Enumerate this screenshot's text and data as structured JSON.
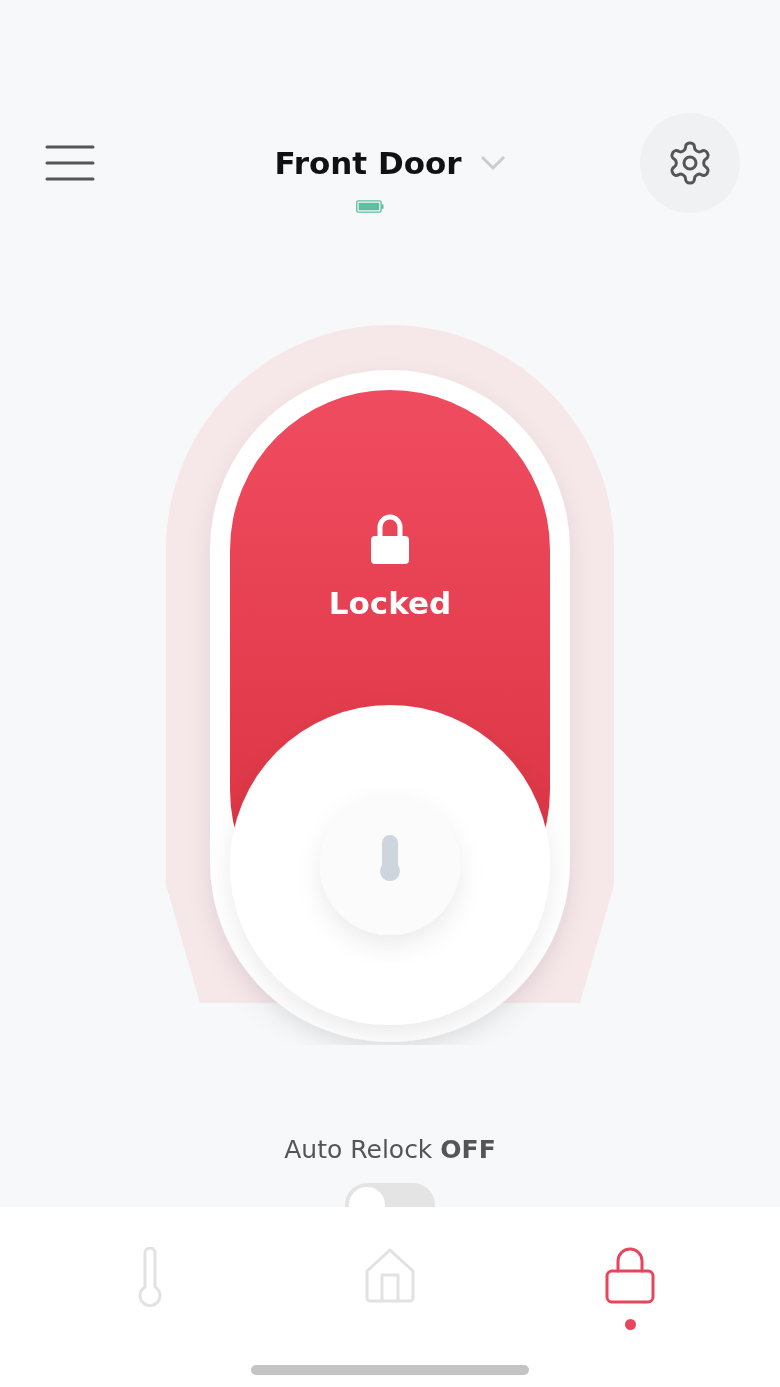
{
  "header": {
    "title": "Front Door"
  },
  "lock": {
    "status": "Locked",
    "locked": true
  },
  "auto_relock": {
    "label": "Auto Relock",
    "value": "OFF",
    "on": false
  },
  "nav": [
    {
      "kind": "thermometer",
      "selected": false
    },
    {
      "kind": "home",
      "selected": false
    },
    {
      "kind": "lock",
      "selected": true
    }
  ]
}
